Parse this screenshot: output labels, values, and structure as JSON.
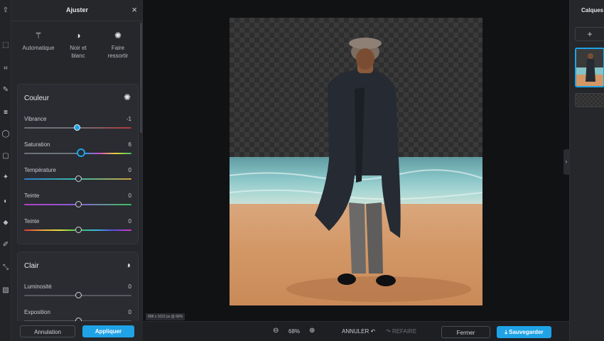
{
  "panel": {
    "title": "Ajuster",
    "close_icon": "×"
  },
  "rail": {
    "icons": [
      "upload-icon",
      "select-icon",
      "crop-icon",
      "brush-icon",
      "adjust-icon",
      "circle-icon",
      "frame-icon",
      "sparkle-icon",
      "retouch-icon",
      "pin-icon",
      "pen-icon",
      "transform-icon",
      "texture-icon"
    ]
  },
  "presets": [
    {
      "label": "Automatique",
      "icon": "magic-wand-icon"
    },
    {
      "label": "Noir et blanc",
      "icon": "contrast-icon"
    },
    {
      "label": "Faire ressortir",
      "icon": "sun-icon"
    }
  ],
  "couleur": {
    "title": "Couleur",
    "icon": "color-wheel-icon",
    "sliders": [
      {
        "label": "Vibrance",
        "value": "-1",
        "level": 0.49
      },
      {
        "label": "Saturation",
        "value": "6",
        "level": 0.53
      },
      {
        "label": "Température",
        "value": "0",
        "level": 0.5
      },
      {
        "label": "Teinte",
        "value": "0",
        "level": 0.5
      },
      {
        "label": "Teinte",
        "value": "0",
        "level": 0.5
      }
    ]
  },
  "clair": {
    "title": "Clair",
    "icon": "contrast-icon",
    "sliders": [
      {
        "label": "Luminosité",
        "value": "0",
        "level": 0.5
      },
      {
        "label": "Exposition",
        "value": "0",
        "level": 0.5
      }
    ]
  },
  "footer": {
    "cancel_label": "Annulation",
    "apply_label": "Appliquer"
  },
  "canvas": {
    "dimensions": "898 x 1022 px @ 68%"
  },
  "bottombar": {
    "zoom": "68%",
    "undo_label": "ANNULER",
    "redo_label": "REFAIRE",
    "close_label": "Fermer",
    "save_label": "Sauvegarder"
  },
  "layers": {
    "title": "Calques",
    "add_icon": "+"
  },
  "colors": {
    "accent": "#1fa3e6",
    "panel": "#25272b",
    "canvas_bg": "#111214"
  }
}
